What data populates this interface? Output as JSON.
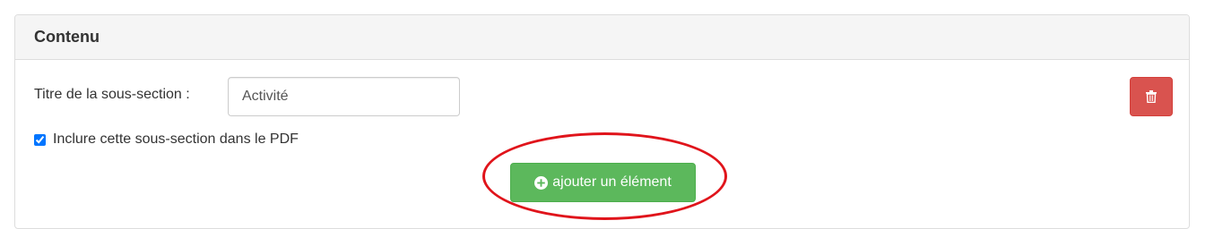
{
  "panel": {
    "title": "Contenu"
  },
  "subsection": {
    "title_label": "Titre de la sous-section :",
    "title_value": "Activité",
    "include_pdf_label": "Inclure cette sous-section dans le PDF",
    "include_pdf_checked": true,
    "delete_icon": "trash-icon",
    "add_button_icon": "plus-circle-icon",
    "add_button_label": "ajouter un élément"
  },
  "colors": {
    "danger": "#d9534f",
    "success": "#5cb85c",
    "annotation": "#e0141b"
  }
}
